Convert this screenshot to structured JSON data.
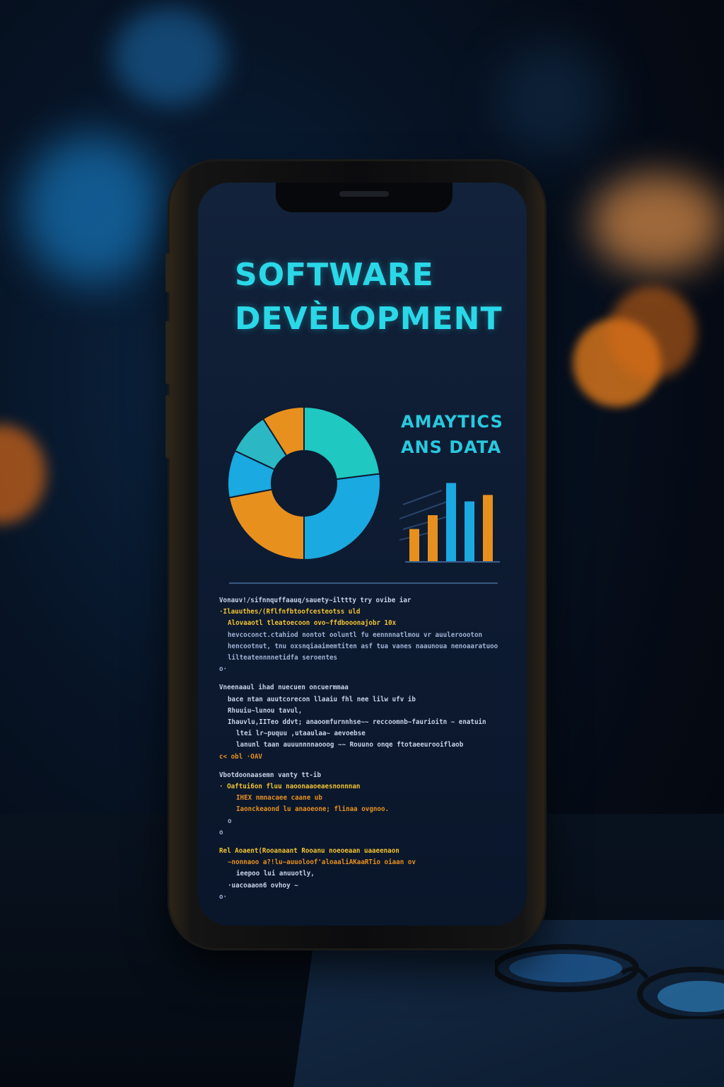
{
  "screen": {
    "title_line1": "SOFTWARE",
    "title_line2": "DEVÈLOPMENT",
    "analytics_line1": "AMAYTICS",
    "analytics_line2": "ANS DATA"
  },
  "colors": {
    "cyan": "#2ad8e8",
    "teal": "#1fc8c0",
    "blue": "#1aa9e0",
    "orange": "#e8901e",
    "green": "#8fe03a",
    "code_text": "#b8c6e0"
  },
  "chart_data": [
    {
      "type": "pie",
      "donut": true,
      "slices": [
        {
          "color": "#1fc8c0",
          "value": 23
        },
        {
          "color": "#1aa9e0",
          "value": 27
        },
        {
          "color": "#e8901e",
          "value": 22
        },
        {
          "color": "#1aa9e0",
          "value": 10
        },
        {
          "color": "#2bb8c4",
          "value": 9
        },
        {
          "color": "#e8901e",
          "value": 9
        }
      ]
    },
    {
      "type": "bar",
      "values": [
        {
          "value": 35,
          "color": "#e8901e"
        },
        {
          "value": 50,
          "color": "#e8901e"
        },
        {
          "value": 85,
          "color": "#1aa9e0"
        },
        {
          "value": 65,
          "color": "#1aa9e0"
        },
        {
          "value": 72,
          "color": "#e8901e"
        }
      ],
      "ylim": [
        0,
        100
      ]
    }
  ],
  "code_lines": [
    {
      "indent": 0,
      "color": "#c7d2e8",
      "text": "Vonauv!/sifnnquffaauq/sauety~ilttty try  ovibe iar"
    },
    {
      "indent": 0,
      "color": "#f2c230",
      "text": "·Ilauuthes/(Rflfnfbtoofcesteotss  uld"
    },
    {
      "indent": 1,
      "color": "#f2c230",
      "text": "Alovaaotl tleatoecoon ovo~ffdbooonajobr 10x"
    },
    {
      "indent": 1,
      "color": "#9fb2d4",
      "text": "hevcoconct.ctahiod nontot ooluntl fu eennnnatlmou vr auuleroooton"
    },
    {
      "indent": 1,
      "color": "#9fb2d4",
      "text": "hencootnut, tnu oxsnqiaaimemtiten asf tua vanes naaunoua nenoaaratuoo"
    },
    {
      "indent": 1,
      "color": "#9fb2d4",
      "text": "lilteatennnnetidfa seroentes"
    },
    {
      "indent": 0,
      "color": "#9fb2d4",
      "text": "o·"
    },
    {
      "indent": 0,
      "color": "#c7d2e8",
      "text": "Vneenaaul ihad nuecuen oncuermmaa"
    },
    {
      "indent": 1,
      "color": "#c7d2e8",
      "text": "bace ntan auutcorecon llaaiu fhl nee lilw ufv ib"
    },
    {
      "indent": 1,
      "color": "#c7d2e8",
      "text": "Rhuuiu~lunou tavul,"
    },
    {
      "indent": 1,
      "color": "#c7d2e8",
      "text": "Ihauvlu,IITeo ddvt; anaoomfurnnhse~~ reccoomnb~faurioitn  ~ enatuin"
    },
    {
      "indent": 2,
      "color": "#c7d2e8",
      "text": "ltei lr~puquu ,utaaulaa~ aevoebse"
    },
    {
      "indent": 2,
      "color": "#c7d2e8",
      "text": "lanunl taan auuunnnnaooog ~~ Rouuno onqe ftotaeeurooiflaob"
    },
    {
      "indent": 0,
      "color": "#e8901e",
      "text": "c< obl ·OAV"
    },
    {
      "indent": 0,
      "color": "#c7d2e8",
      "text": "Vbotdoonaasemn vanty tt-ib"
    },
    {
      "indent": 0,
      "color": "#f2c230",
      "text": "·  Oaftui6on fluu naoonaaoeaesnonnnan"
    },
    {
      "indent": 2,
      "color": "#e8901e",
      "text": "IHEX nmnacaee caane ub"
    },
    {
      "indent": 2,
      "color": "#e8901e",
      "text": "Iaonckeaond lu anaoeone; flinaa ovgnoo."
    },
    {
      "indent": 1,
      "color": "#9fb2d4",
      "text": "o"
    },
    {
      "indent": 0,
      "color": "#9fb2d4",
      "text": "o"
    },
    {
      "indent": 0,
      "color": "#f2c230",
      "text": "Rel Aoaent(Rooanaant  Rooanu noeoeaan uaaeenaon"
    },
    {
      "indent": 1,
      "color": "#e8901e",
      "text": "~nonnaoo a?!lu~auuoloof'aloaaliAKaaRTio oiaan ov"
    },
    {
      "indent": 2,
      "color": "#c7d2e8",
      "text": "ieepoo lui anuuotly,"
    },
    {
      "indent": 1,
      "color": "#c7d2e8",
      "text": "·uacoaaon6 ovhoy ~"
    },
    {
      "indent": 0,
      "color": "#9fb2d4",
      "text": "o·"
    }
  ]
}
